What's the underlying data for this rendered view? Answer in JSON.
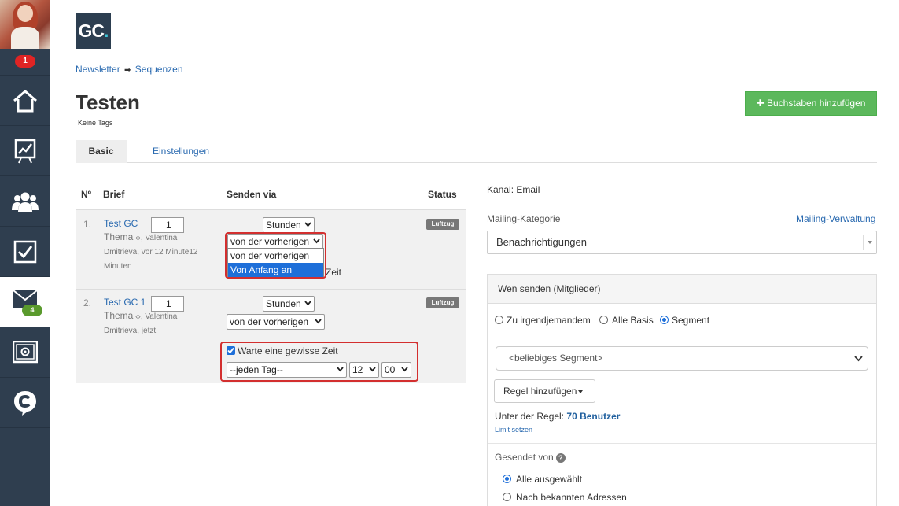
{
  "sidebar": {
    "notification_count": "1",
    "mail_count": "4",
    "items": [
      {
        "name": "home-icon"
      },
      {
        "name": "chart-board-icon"
      },
      {
        "name": "users-icon"
      },
      {
        "name": "checkbox-icon"
      },
      {
        "name": "mail-icon"
      },
      {
        "name": "safe-icon"
      },
      {
        "name": "chat-c-icon"
      }
    ]
  },
  "logo": {
    "text": "GC",
    "dot": "."
  },
  "breadcrumb": {
    "newsletter": "Newsletter",
    "arrow": "➡",
    "sequences": "Sequenzen"
  },
  "page": {
    "title": "Testen",
    "tags": "Keine Tags"
  },
  "add_button": {
    "icon": "✚",
    "label": "Buchstaben hinzufügen"
  },
  "tabs": {
    "basic": "Basic",
    "settings": "Einstellungen"
  },
  "table": {
    "headers": {
      "num": "Nº",
      "letter": "Brief",
      "send_via": "Senden via",
      "status": "Status"
    },
    "rows": [
      {
        "num": "1.",
        "title": "Test GC",
        "thema": "Thema",
        "link_icon": "‹›",
        "meta": ", Valentina Dmitrieva, vor 12 Minute12 Minuten",
        "amount": "1",
        "unit": "Stunden",
        "relative": "von der vorherigen",
        "status": "Luftzug"
      },
      {
        "num": "2.",
        "title": "Test GC 1",
        "thema": "Thema",
        "link_icon": "‹›",
        "meta": ", Valentina Dmitrieva, jetzt",
        "amount": "1",
        "unit": "Stunden",
        "relative": "von der vorherigen",
        "status": "Luftzug",
        "wait_label": "Warte eine gewisse Zeit",
        "wait_checked": true,
        "day": "--jeden Tag--",
        "hour": "12",
        "minute": "00"
      }
    ]
  },
  "dropdown": {
    "options": [
      "von der vorherigen",
      "Von Anfang an"
    ],
    "highlighted": "Von Anfang an",
    "partial_text": "Zeit"
  },
  "right": {
    "channel": "Kanal: Email",
    "mailing_category_label": "Mailing-Kategorie",
    "mailing_management": "Mailing-Verwaltung",
    "category_value": "Benachrichtigungen",
    "send_to_title": "Wen senden (Mitglieder)",
    "radio_options": [
      "Zu irgendjemandem",
      "Alle Basis",
      "Segment"
    ],
    "radio_selected": "Segment",
    "segment_value": "<beliebiges Segment>",
    "add_rule": "Regel hinzufügen",
    "under_rule_label": "Unter der Regel:",
    "under_rule_value": "70 Benutzer",
    "limit": "Limit setzen",
    "sent_from": "Gesendet von",
    "help": "?",
    "sent_options": [
      "Alle ausgewählt",
      "Nach bekannten Adressen"
    ],
    "sent_selected": "Alle ausgewählt"
  },
  "colors": {
    "sidebar": "#2f3e4f",
    "link": "#2a6ab0",
    "success": "#5cb85c",
    "highlight_red": "#d32f2f",
    "select_blue": "#1e6fd9"
  }
}
